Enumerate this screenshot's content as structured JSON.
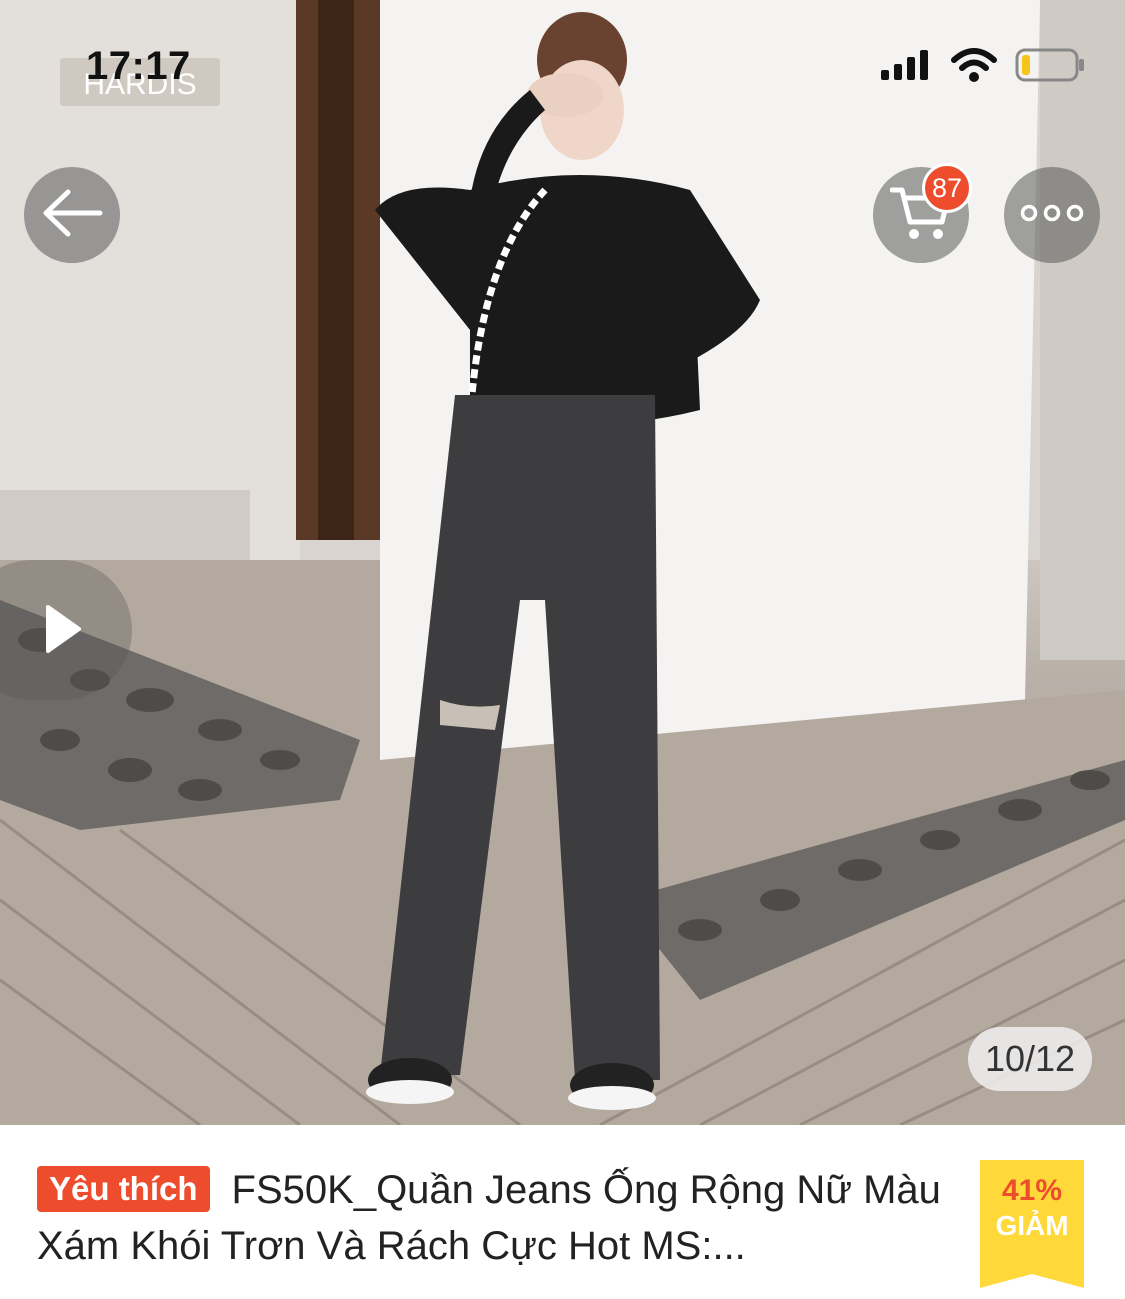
{
  "status_bar": {
    "time": "17:17",
    "battery_level": 0.15
  },
  "sign_text": "HARDIS",
  "header": {
    "cart_count": "87"
  },
  "gallery": {
    "counter": "10/12"
  },
  "product": {
    "badge": "Yêu thích",
    "title": "FS50K_Quần Jeans Ống Rộng Nữ Màu Xám Khói Trơn Và Rách Cực Hot MS:...",
    "discount_percent": "41%",
    "discount_label": "GIẢM"
  },
  "colors": {
    "accent": "#ee4d2d",
    "discount_bg": "#ffd839"
  },
  "icons": [
    "back-arrow-icon",
    "cart-icon",
    "more-icon",
    "play-icon",
    "signal-icon",
    "wifi-icon",
    "battery-icon"
  ]
}
